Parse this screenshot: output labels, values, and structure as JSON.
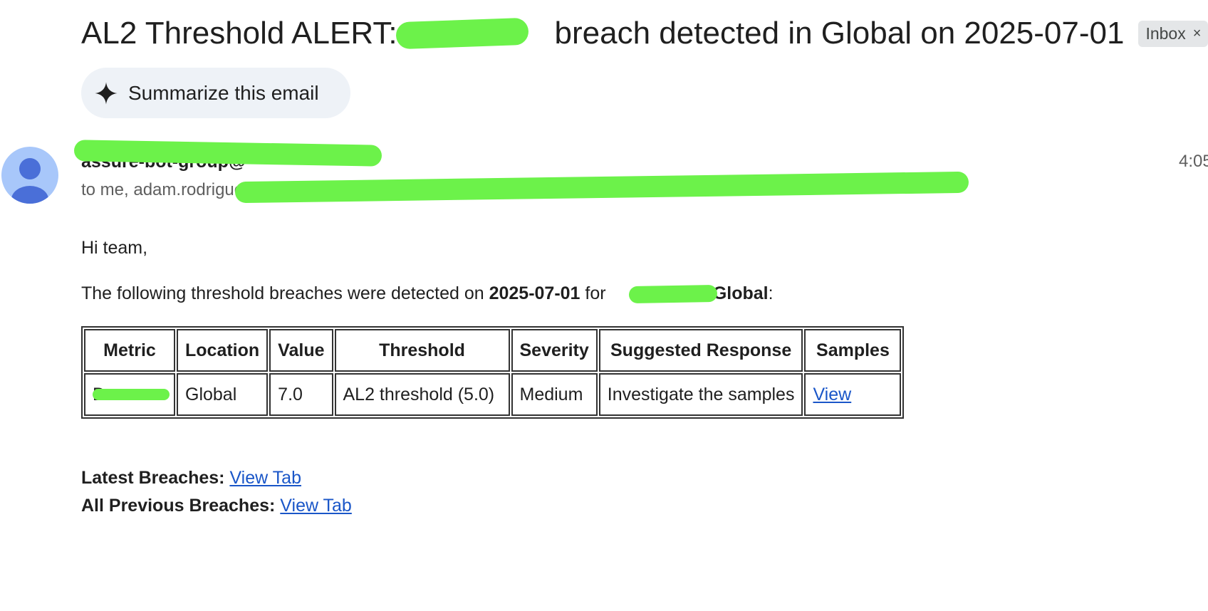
{
  "email": {
    "subject_prefix": "AL2 Threshold ALERT: D",
    "subject_suffix": "breach detected in Global on 2025-07-01",
    "inbox_label": "Inbox",
    "inbox_close": "×",
    "summarize_label": "Summarize this email",
    "sender": "assure-bot-group@",
    "recipients": "to me, adam.rodriguez, … pchens, calitre… l, penikhalyadav, jess… , …, … hithe",
    "time": "4:05"
  },
  "body": {
    "greeting": "Hi team,",
    "intro_text": "The following threshold breaches were detected on",
    "intro_date": "2025-07-01",
    "intro_for": "for",
    "intro_region": "- Global",
    "intro_end": ":"
  },
  "table": {
    "headers": [
      "Metric",
      "Location",
      "Value",
      "Threshold",
      "Severity",
      "Suggested Response",
      "Samples"
    ],
    "row": {
      "metric": "D…",
      "location": "Global",
      "value": "7.0",
      "threshold": "AL2 threshold (5.0)",
      "severity": "Medium",
      "response": "Investigate the samples",
      "samples_link": "View"
    }
  },
  "footer": {
    "latest_label": "Latest Breaches:",
    "latest_link": "View Tab",
    "previous_label": "All Previous Breaches:",
    "previous_link": "View Tab"
  },
  "colors": {
    "link": "#1a56c8",
    "redaction": "#6cf24a",
    "avatar_bg": "#a8c7fa",
    "avatar_fg": "#4a6fd8",
    "summarize_bg": "#eef2f7"
  },
  "icons": {
    "sparkle": "sparkle-icon",
    "avatar": "default-avatar-icon",
    "close": "close-icon"
  }
}
